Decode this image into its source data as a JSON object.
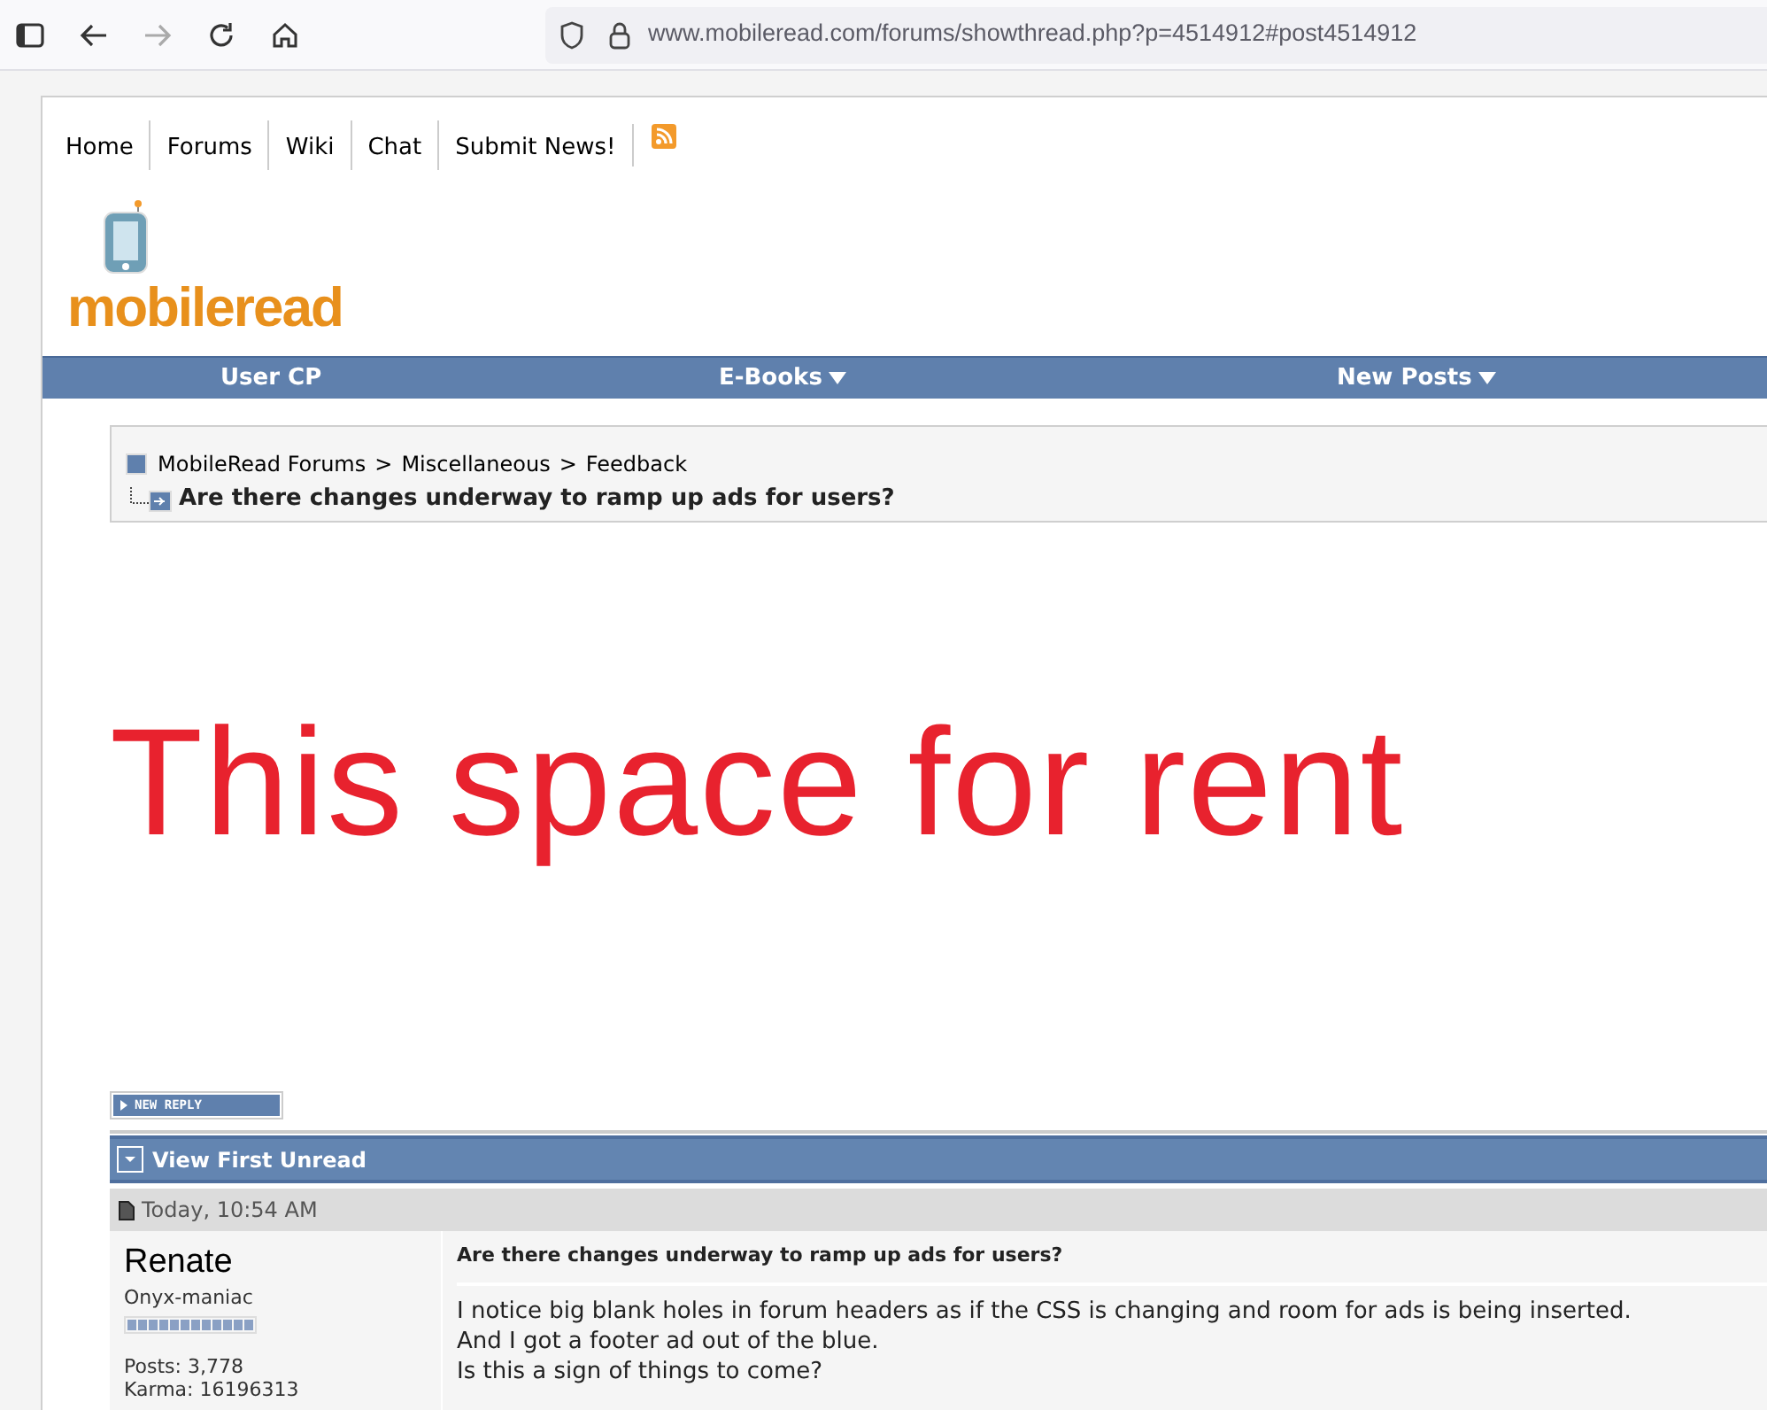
{
  "browser": {
    "url": "www.mobileread.com/forums/showthread.php?p=4514912#post4514912"
  },
  "top_links": [
    "Home",
    "Forums",
    "Wiki",
    "Chat",
    "Submit News!"
  ],
  "logo": {
    "text": "mobileread"
  },
  "navbar": [
    {
      "label": "User CP",
      "dropdown": false
    },
    {
      "label": "E-Books",
      "dropdown": true
    },
    {
      "label": "New Posts",
      "dropdown": true
    }
  ],
  "breadcrumb": {
    "path": [
      "MobileRead Forums",
      "Miscellaneous",
      "Feedback"
    ],
    "separator": ">",
    "title": "Are there changes underway to ramp up ads for users?"
  },
  "banner": "This space for rent",
  "new_reply": "NEW REPLY",
  "thread_bar": "View First Unread",
  "post": {
    "date": "Today, 10:54 AM",
    "user": "Renate",
    "rank": "Onyx-maniac",
    "stats": [
      "Posts: 3,778",
      "Karma: 16196313"
    ],
    "title": "Are there changes underway to ramp up ads for users?",
    "lines": [
      "I notice big blank holes in forum headers as if the CSS is changing and room for ads is being inserted.",
      "And I got a footer ad out of the blue.",
      "Is this a sign of things to come?"
    ]
  }
}
